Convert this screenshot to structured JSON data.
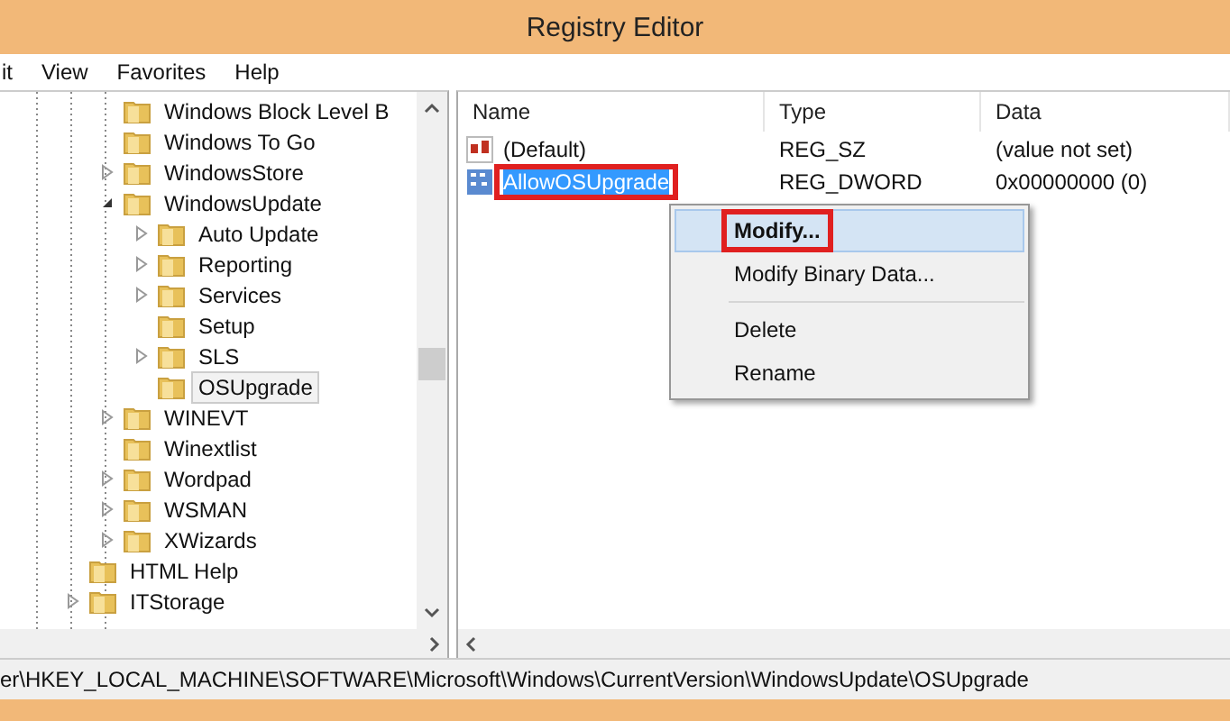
{
  "window": {
    "title": "Registry Editor"
  },
  "menu": [
    {
      "label": "it"
    },
    {
      "label": "View"
    },
    {
      "label": "Favorites"
    },
    {
      "label": "Help"
    }
  ],
  "tree": [
    {
      "children": [
        {
          "label": "Windows Block Level B",
          "has_children": false,
          "selected": false
        },
        {
          "label": "Windows To Go",
          "has_children": false,
          "selected": false
        },
        {
          "label": "WindowsStore",
          "has_children": true,
          "expanded": false,
          "selected": false
        },
        {
          "label": "WindowsUpdate",
          "has_children": true,
          "expanded": true,
          "selected": false,
          "children": [
            {
              "label": "Auto Update",
              "has_children": true,
              "expanded": false,
              "selected": false
            },
            {
              "label": "Reporting",
              "has_children": true,
              "expanded": false,
              "selected": false
            },
            {
              "label": "Services",
              "has_children": true,
              "expanded": false,
              "selected": false
            },
            {
              "label": "Setup",
              "has_children": false,
              "selected": false
            },
            {
              "label": "SLS",
              "has_children": true,
              "expanded": false,
              "selected": false
            },
            {
              "label": "OSUpgrade",
              "has_children": false,
              "selected": true
            }
          ]
        },
        {
          "label": "WINEVT",
          "has_children": true,
          "expanded": false,
          "selected": false
        },
        {
          "label": "Winextlist",
          "has_children": false,
          "selected": false
        },
        {
          "label": "Wordpad",
          "has_children": true,
          "expanded": false,
          "selected": false
        },
        {
          "label": "WSMAN",
          "has_children": true,
          "expanded": false,
          "selected": false
        },
        {
          "label": "XWizards",
          "has_children": true,
          "expanded": false,
          "selected": false
        }
      ]
    },
    {
      "label": "HTML Help",
      "has_children": false,
      "selected": false
    },
    {
      "label": "ITStorage",
      "has_children": true,
      "expanded": false,
      "selected": false
    }
  ],
  "values": {
    "columns": [
      "Name",
      "Type",
      "Data"
    ],
    "rows": [
      {
        "kind": "string",
        "name": "(Default)",
        "type": "REG_SZ",
        "data": "(value not set)",
        "selected": false,
        "outlined": false
      },
      {
        "kind": "binary",
        "name": "AllowOSUpgrade",
        "type": "REG_DWORD",
        "data": "0x00000000 (0)",
        "selected": true,
        "outlined": true
      }
    ]
  },
  "context_menu": [
    {
      "kind": "item",
      "label": "Modify...",
      "default": true,
      "selected": true,
      "outlined": true
    },
    {
      "kind": "item",
      "label": "Modify Binary Data...",
      "default": false,
      "selected": false,
      "outlined": false
    },
    {
      "kind": "separator"
    },
    {
      "kind": "item",
      "label": "Delete",
      "default": false,
      "selected": false,
      "outlined": false
    },
    {
      "kind": "item",
      "label": "Rename",
      "default": false,
      "selected": false,
      "outlined": false
    }
  ],
  "status_bar": "er\\HKEY_LOCAL_MACHINE\\SOFTWARE\\Microsoft\\Windows\\CurrentVersion\\WindowsUpdate\\OSUpgrade"
}
